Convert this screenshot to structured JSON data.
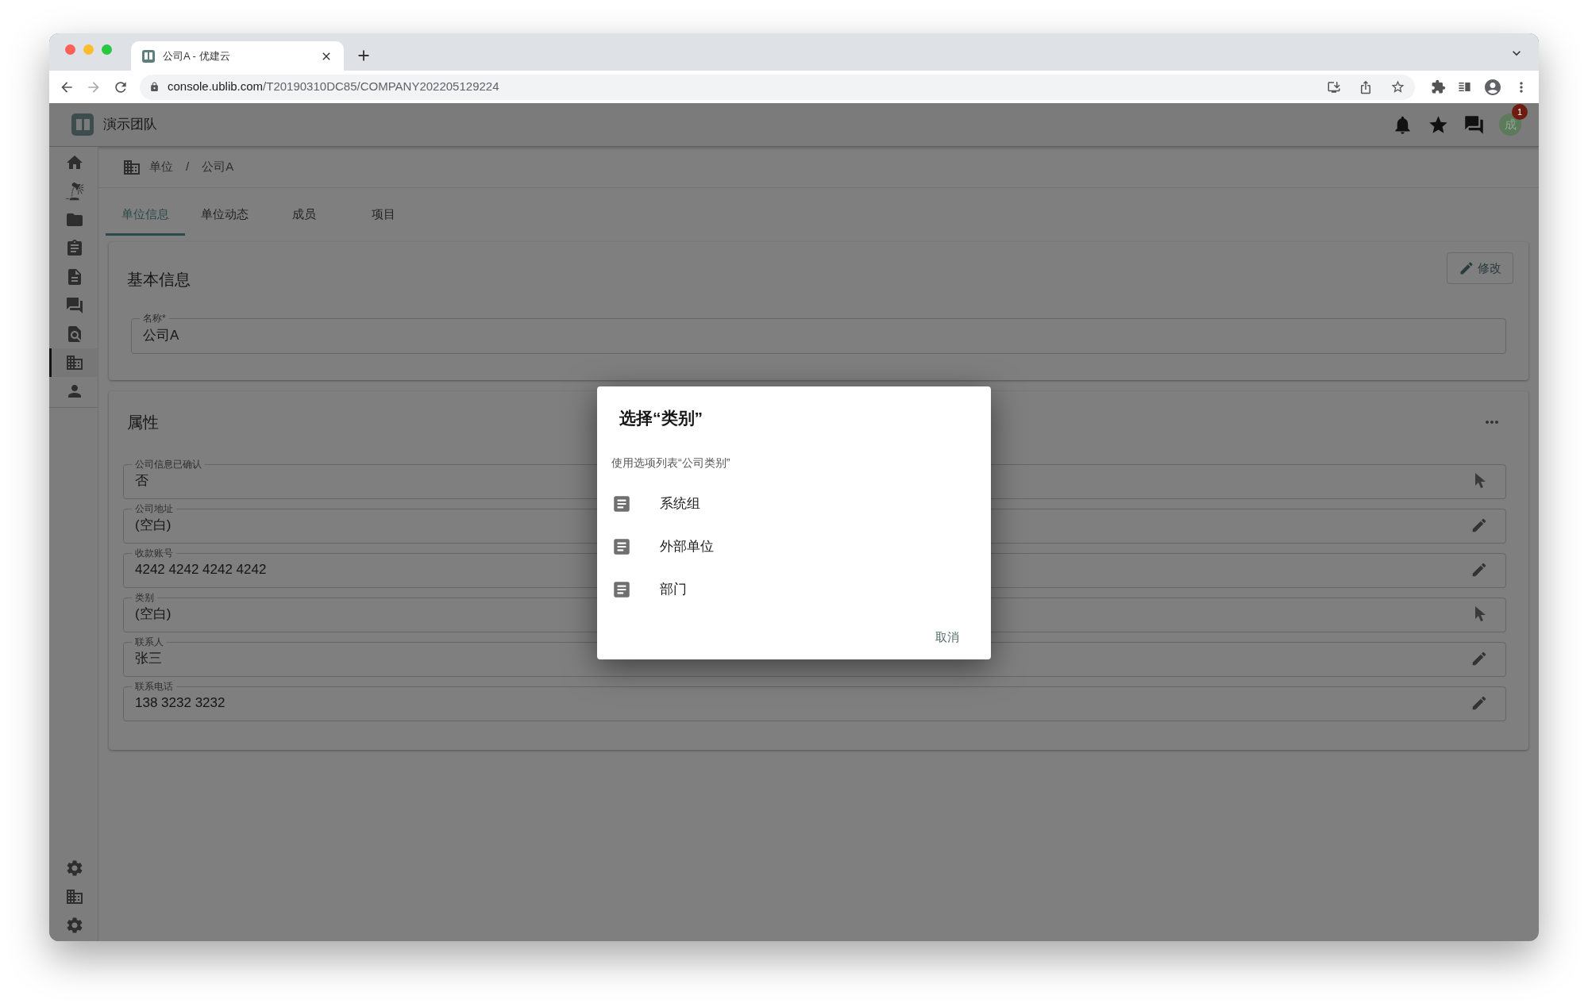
{
  "browser": {
    "tab_title": "公司A - 优建云",
    "url_host": "console.ublib.com",
    "url_path": "/T20190310DC85/COMPANY202205129224"
  },
  "header": {
    "team_name": "演示团队",
    "notification_count": "1",
    "avatar_text": "成"
  },
  "sidebar": {
    "items": [
      {
        "selected": false
      },
      {
        "selected": false
      },
      {
        "selected": false
      },
      {
        "selected": false
      },
      {
        "selected": false
      },
      {
        "selected": false
      },
      {
        "selected": false
      },
      {
        "selected": true
      },
      {
        "selected": false
      }
    ]
  },
  "breadcrumb": {
    "items": [
      "单位",
      "公司A"
    ],
    "separator": "/"
  },
  "tabs": [
    {
      "label": "单位信息",
      "selected": true
    },
    {
      "label": "单位动态",
      "selected": false
    },
    {
      "label": "成员",
      "selected": false
    },
    {
      "label": "项目",
      "selected": false
    }
  ],
  "basic_info": {
    "title": "基本信息",
    "edit_button": "修改",
    "name_field": {
      "label": "名称*",
      "value": "公司A"
    }
  },
  "properties": {
    "title": "属性",
    "fields": [
      {
        "label": "公司信息已确认",
        "value": "否",
        "kind": "select"
      },
      {
        "label": "公司地址",
        "value": "(空白)",
        "kind": "edit"
      },
      {
        "label": "收款账号",
        "value": "4242 4242 4242 4242",
        "kind": "edit"
      },
      {
        "label": "类别",
        "value": "(空白)",
        "kind": "select"
      },
      {
        "label": "联系人",
        "value": "张三",
        "kind": "edit"
      },
      {
        "label": "联系电话",
        "value": "138 3232 3232",
        "kind": "edit"
      }
    ]
  },
  "dialog": {
    "title": "选择“类别”",
    "subtitle": "使用选项列表“公司类别”",
    "options": [
      "系统组",
      "外部单位",
      "部门"
    ],
    "cancel": "取消"
  }
}
